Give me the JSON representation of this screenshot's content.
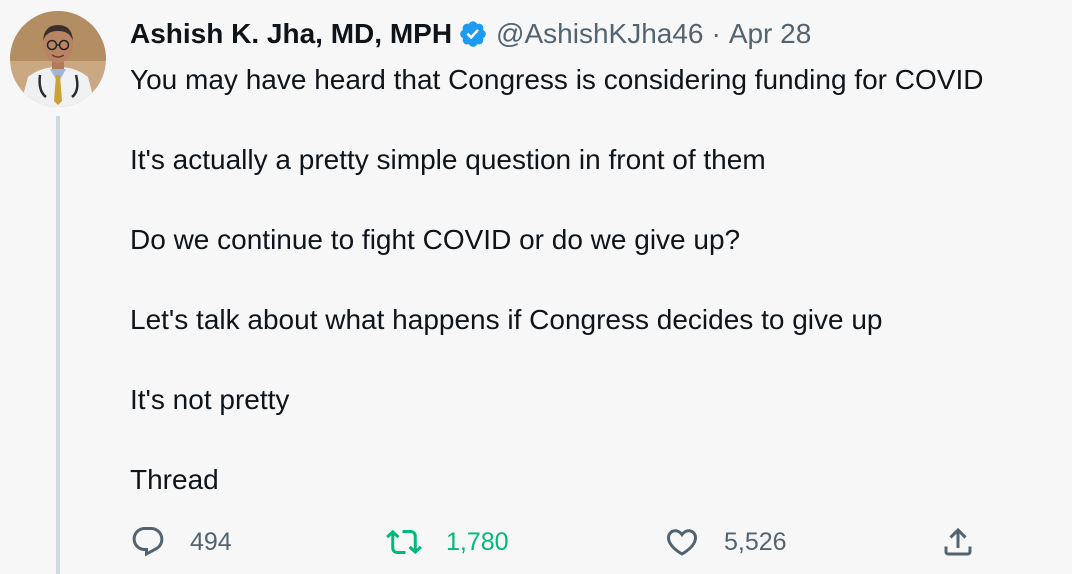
{
  "tweet": {
    "author": {
      "display_name": "Ashish K. Jha, MD, MPH",
      "handle": "@AshishKJha46",
      "verified": true,
      "avatar": "avatar-photo"
    },
    "separator": "·",
    "date": "Apr 28",
    "paragraphs": [
      "You may have heard that Congress is considering funding for COVID",
      "It's actually a pretty simple question in front of them",
      "Do we continue to fight COVID or do we give up?",
      "Let's talk about what happens if Congress decides to give up",
      "It's not pretty",
      "Thread"
    ],
    "actions": {
      "reply": {
        "icon": "reply-icon",
        "count": "494"
      },
      "retweet": {
        "icon": "retweet-icon",
        "count": "1,780",
        "active": true
      },
      "like": {
        "icon": "heart-icon",
        "count": "5,526"
      },
      "share": {
        "icon": "share-icon"
      }
    }
  },
  "colors": {
    "background": "#f7f7f8",
    "text": "#0f1419",
    "secondary": "#536471",
    "verified_blue": "#1d9bf0",
    "retweet_green": "#00ba7c",
    "thread_line": "#cfd9de"
  }
}
